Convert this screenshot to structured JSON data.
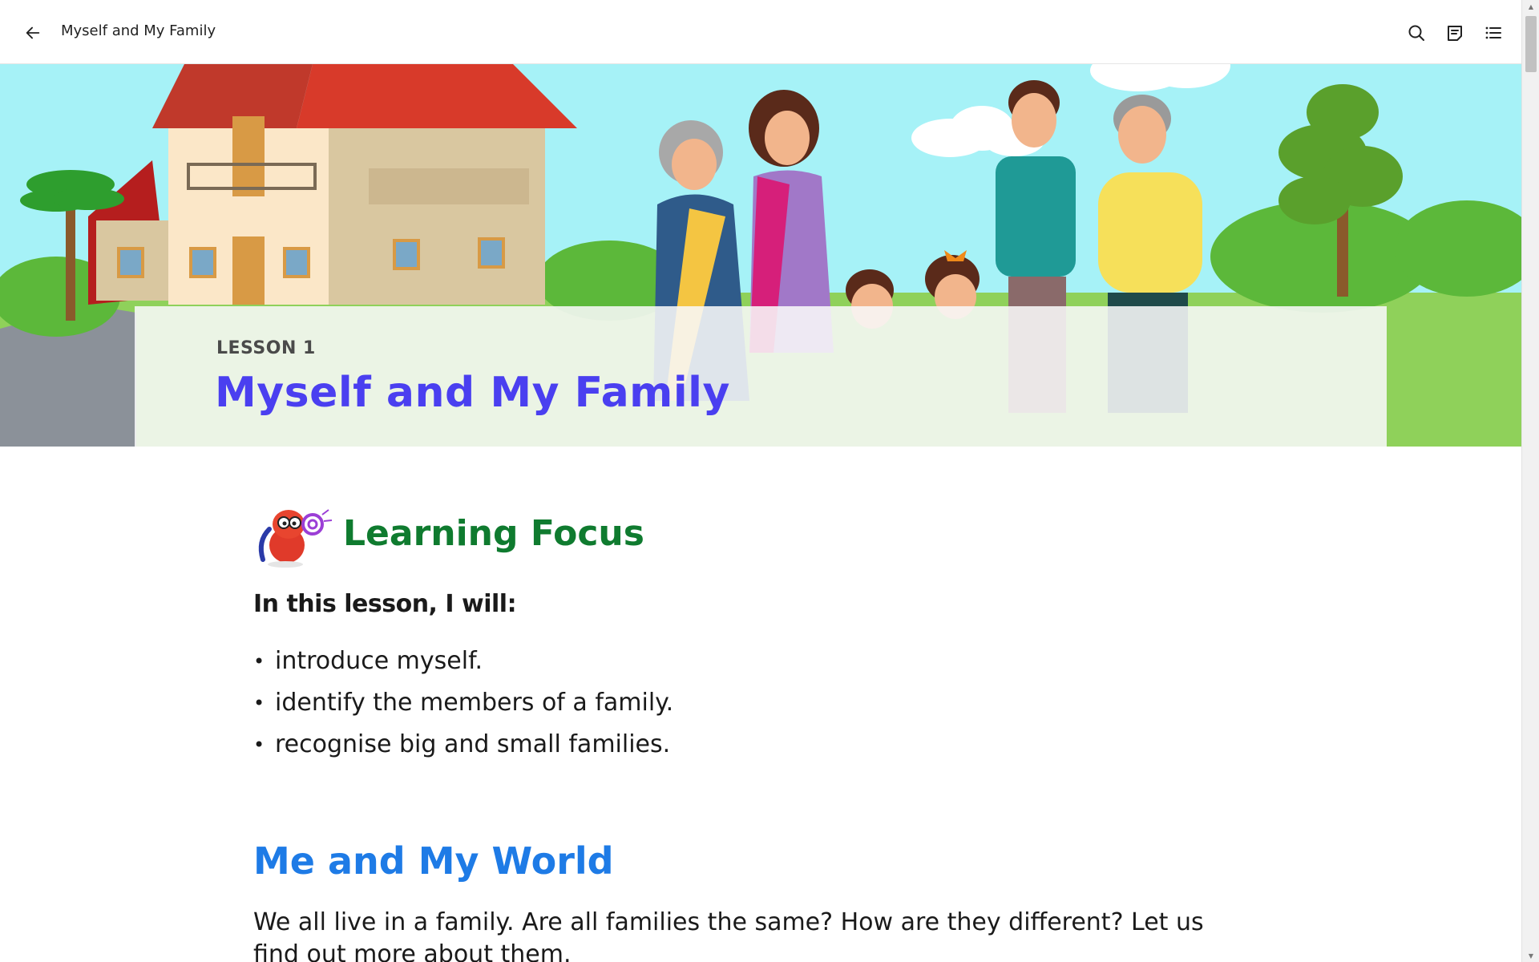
{
  "header": {
    "title": "Myself and My Family",
    "back_icon": "arrow-left-icon",
    "search_icon": "search-icon",
    "notes_icon": "notes-icon",
    "toc_icon": "list-icon"
  },
  "hero": {
    "lesson_label": "LESSON 1",
    "lesson_title": "Myself and My Family"
  },
  "learning_focus": {
    "title": "Learning Focus",
    "intro": "In this lesson, I will:",
    "bullet": "•",
    "items": [
      "introduce myself.",
      "identify the members of a family.",
      "recognise big and small families."
    ]
  },
  "section": {
    "title": "Me and My World",
    "paragraph": "We all live in a family. Are all families the same? How are they different? Let us find out more about them."
  },
  "colors": {
    "lesson_title": "#4a3ff0",
    "focus_title": "#0f7b2f",
    "section_title": "#1e7be6",
    "sky": "#a6f2f7",
    "grass": "#8fd15a"
  }
}
